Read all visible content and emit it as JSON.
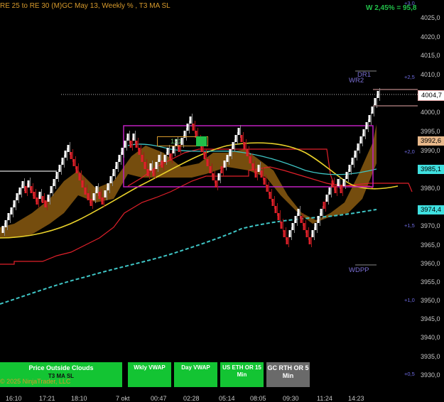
{
  "header": {
    "title": "RE 25 to RE 30 (M)GC May 13, Weekly % , T3 MA SL",
    "weekly_perf": "W 2,45% = 95,8"
  },
  "price_axis": {
    "labels": [
      "4025,0",
      "4020,0",
      "4015,0",
      "4010,0",
      "4000,0",
      "3995,0",
      "3990,0",
      "3980,0",
      "3970,0",
      "3965,0",
      "3960,0",
      "3955,0",
      "3950,0",
      "3945,0",
      "3940,0",
      "3935,0",
      "3930,0"
    ],
    "current_price": "4004,7",
    "tag_3992": "3992,6",
    "tag_3985": "3985,1",
    "tag_3974": "3974,4"
  },
  "pct_labels": [
    "+3,0",
    "+2,5",
    "+2,0",
    "+1,5",
    "+1,0",
    "+0,5"
  ],
  "level_tags": {
    "dr1": "DR1",
    "wr2": "WR2",
    "wdpp": "WDPP"
  },
  "box_value": "121",
  "time_axis": [
    "16:10",
    "17:21",
    "18:10",
    "7 okt",
    "00:47",
    "02:28",
    "05:14",
    "08:05",
    "09:30",
    "11:24",
    "14:23"
  ],
  "buttons": [
    {
      "label": "Price Outside Clouds",
      "sub": "T3 MA SL"
    },
    {
      "label": "Wkly VWAP",
      "sub": ""
    },
    {
      "label": "Day VWAP",
      "sub": ""
    },
    {
      "label": "US ETH OR 15 Min",
      "sub": ""
    },
    {
      "label": "GC RTH OR 5 Min",
      "sub": ""
    }
  ],
  "copyright": "© 2025 NinjaTrader, LLC",
  "colors": {
    "bg": "#000000",
    "up": "#ffffff",
    "down": "#e0202a",
    "cloud": "#8a5a10",
    "ma": "#e8d02a",
    "vwap": "#3fc6c6",
    "box": "#c020c0"
  }
}
